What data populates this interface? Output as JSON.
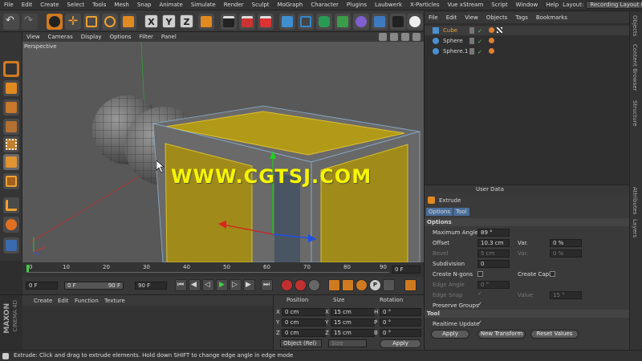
{
  "menubar": {
    "items": [
      "File",
      "Edit",
      "Create",
      "Select",
      "Tools",
      "Mesh",
      "Snap",
      "Animate",
      "Simulate",
      "Render",
      "Sculpt",
      "MoGraph",
      "Character",
      "Plugins",
      "Laubwerk",
      "X-Particles",
      "Vue xStream",
      "Script",
      "Window",
      "Help"
    ],
    "layout_label": "Layout:",
    "layout_value": "Recording Layout (User)"
  },
  "toolbar": {
    "x_label": "X",
    "y_label": "Y",
    "z_label": "Z"
  },
  "viewport": {
    "menu": [
      "View",
      "Cameras",
      "Display",
      "Options",
      "Filter",
      "Panel"
    ],
    "label": "Perspective",
    "watermark": "WWW.CGTSJ.COM"
  },
  "timeline": {
    "ticks": [
      "0",
      "10",
      "20",
      "30",
      "40",
      "50",
      "60",
      "70",
      "80",
      "90"
    ],
    "end_frame": "0 F"
  },
  "transport": {
    "start": "0 F",
    "current": "0 F",
    "end": "90 F",
    "max": "90 F"
  },
  "material_manager": {
    "menu": [
      "Create",
      "Edit",
      "Function",
      "Texture"
    ],
    "brand1": "MAXON",
    "brand2": "CINEMA 4D"
  },
  "coordinates": {
    "headers": [
      "Position",
      "Size",
      "Rotation"
    ],
    "rows": [
      {
        "axis": "X",
        "pos": "0 cm",
        "size_axis": "X",
        "size": "15 cm",
        "rot_axis": "H",
        "rot": "0 °"
      },
      {
        "axis": "Y",
        "pos": "0 cm",
        "size_axis": "Y",
        "size": "15 cm",
        "rot_axis": "P",
        "rot": "0 °"
      },
      {
        "axis": "Z",
        "pos": "0 cm",
        "size_axis": "Z",
        "size": "15 cm",
        "rot_axis": "B",
        "rot": "0 °"
      }
    ],
    "mode": "Object (Rel)",
    "size_mode": "Size",
    "apply": "Apply"
  },
  "object_manager": {
    "menu": [
      "File",
      "Edit",
      "View",
      "Objects",
      "Tags",
      "Bookmarks"
    ],
    "objects": [
      {
        "name": "Cube",
        "color": "#f0a030"
      },
      {
        "name": "Sphere",
        "color": "#dddddd"
      },
      {
        "name": "Sphere.1",
        "color": "#dddddd"
      }
    ]
  },
  "attributes": {
    "header": "User Data",
    "title": "Extrude",
    "tabs": [
      "Options",
      "Tool"
    ],
    "section_options": "Options",
    "maximum_angle_label": "Maximum Angle",
    "maximum_angle": "89 °",
    "offset_label": "Offset",
    "offset": "10.3 cm",
    "var_label": "Var.",
    "offset_var": "0 %",
    "bevel_label": "Bevel",
    "bevel": "5 cm",
    "bevel_var": "0 %",
    "subdivision_label": "Subdivision",
    "subdivision": "0",
    "create_ngons": "Create N-gons",
    "create_caps": "Create Caps",
    "edge_angle_label": "Edge Angle",
    "edge_angle": "0 °",
    "edge_snap_label": "Edge Snap",
    "value_label": "Value",
    "value": "15 °",
    "preserve_groups": "Preserve Groups",
    "section_tool": "Tool",
    "realtime_update": "Realtime Update",
    "btn_apply": "Apply",
    "btn_new_transform": "New Transform",
    "btn_reset_values": "Reset Values"
  },
  "side_tabs": [
    "Objects",
    "Content Browser",
    "Structure",
    "Attributes",
    "Layers"
  ],
  "status": "Extrude: Click and drag to extrude elements. Hold down SHIFT to change edge angle in edge mode",
  "colors": {
    "accent_orange": "#f0a030",
    "selection_yellow": "#b8a020",
    "watermark": "#f5f500",
    "ui_bg": "#3a3a3a"
  }
}
